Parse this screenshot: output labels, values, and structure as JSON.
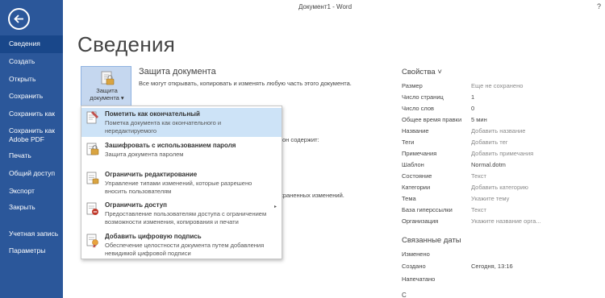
{
  "titlebar": {
    "title": "Документ1 - Word",
    "help": "?"
  },
  "sidebar": {
    "back_icon": "arrow-left-icon",
    "items": [
      {
        "label": "Сведения",
        "active": true
      },
      {
        "label": "Создать"
      },
      {
        "label": "Открыть"
      },
      {
        "label": "Сохранить"
      },
      {
        "label": "Сохранить как"
      },
      {
        "label": "Сохранить как Adobe PDF"
      },
      {
        "label": "Печать"
      },
      {
        "label": "Общий доступ"
      },
      {
        "label": "Экспорт"
      },
      {
        "label": "Закрыть"
      },
      {
        "label": "Учетная запись"
      },
      {
        "label": "Параметры"
      }
    ],
    "color": "#2b579a"
  },
  "main": {
    "title": "Сведения",
    "protect": {
      "tile_label": "Защита документа ▾",
      "section_title": "Защита документа",
      "section_desc": "Все могут открывать, копировать и изменять любую часть этого документа.",
      "partial_1": "он содержит:",
      "partial_2": "охраненных изменений."
    },
    "menu": {
      "items": [
        {
          "title": "Пометить как окончательный",
          "desc": "Пометка документа как окончательного и нередактируемого",
          "icon": "final-mark-icon",
          "highlighted": true
        },
        {
          "title": "Зашифровать с использованием пароля",
          "desc": "Защита документа паролем",
          "icon": "lock-key-icon"
        },
        {
          "title": "Ограничить редактирование",
          "desc": "Управление типами изменений, которые разрешено вносить пользователям",
          "icon": "restrict-editing-icon"
        },
        {
          "title": "Ограничить доступ",
          "desc": "Предоставление пользователям доступа с ограничением возможности изменения, копирования и печати",
          "icon": "restrict-access-icon",
          "has_submenu": true
        },
        {
          "title": "Добавить цифровую подпись",
          "desc": "Обеспечение целостности документа путем добавления невидимой цифровой подписи",
          "icon": "digital-signature-icon"
        }
      ],
      "highlight_color": "#cde3f7"
    }
  },
  "properties": {
    "title": "Свойства ˅",
    "rows": [
      {
        "key": "Размер",
        "value": "Еще не сохранено",
        "muted": true
      },
      {
        "key": "Число страниц",
        "value": "1"
      },
      {
        "key": "Число слов",
        "value": "0"
      },
      {
        "key": "Общее время правки",
        "value": "5 мин"
      },
      {
        "key": "Название",
        "value": "Добавить название",
        "muted": true
      },
      {
        "key": "Теги",
        "value": "Добавить тег",
        "muted": true
      },
      {
        "key": "Примечания",
        "value": "Добавить примечания",
        "muted": true
      },
      {
        "key": "Шаблон",
        "value": "Normal.dotm"
      },
      {
        "key": "Состояние",
        "value": "Текст",
        "muted": true
      },
      {
        "key": "Категории",
        "value": "Добавить категорию",
        "muted": true
      },
      {
        "key": "Тема",
        "value": "Укажите тему",
        "muted": true
      },
      {
        "key": "База гиперссылки",
        "value": "Текст",
        "muted": true
      },
      {
        "key": "Организация",
        "value": "Укажите название орга...",
        "muted": true
      }
    ],
    "related_title": "Связанные даты",
    "date_rows": [
      {
        "key": "Изменено",
        "value": ""
      },
      {
        "key": "Создано",
        "value": "Сегодня, 13:16"
      },
      {
        "key": "Напечатано",
        "value": ""
      }
    ],
    "peek": "С"
  }
}
